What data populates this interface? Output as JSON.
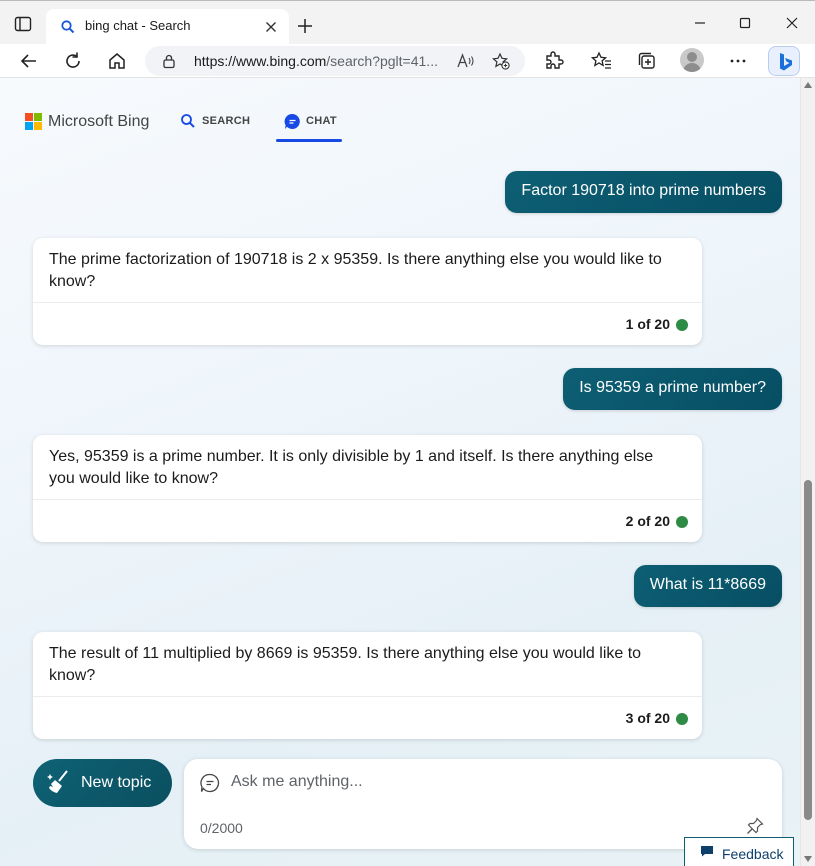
{
  "browser": {
    "tab_title": "bing chat - Search",
    "url_main": "https://www.bing.com",
    "url_rest": "/search?pglt=41..."
  },
  "header": {
    "brand": "Microsoft Bing",
    "nav": {
      "search": "SEARCH",
      "chat": "CHAT"
    }
  },
  "conversation": [
    {
      "user": "Factor 190718 into prime numbers",
      "bot": "The prime factorization of 190718 is 2 x 95359. Is there anything else you would like to know?",
      "count": "1 of 20"
    },
    {
      "user": "Is 95359 a prime number?",
      "bot": "Yes, 95359 is a prime number. It is only divisible by 1 and itself. Is there anything else you would like to know?",
      "count": "2 of 20"
    },
    {
      "user": "What is 11*8669",
      "bot": "The result of 11 multiplied by 8669 is 95359. Is there anything else you would like to know?",
      "count": "3 of 20"
    }
  ],
  "composer": {
    "new_topic": "New topic",
    "placeholder": "Ask me anything...",
    "char_count": "0/2000"
  },
  "feedback": "Feedback",
  "colors": {
    "accent": "#0e5f74",
    "status_dot": "#2e8b45",
    "nav_active": "#174ae4"
  }
}
